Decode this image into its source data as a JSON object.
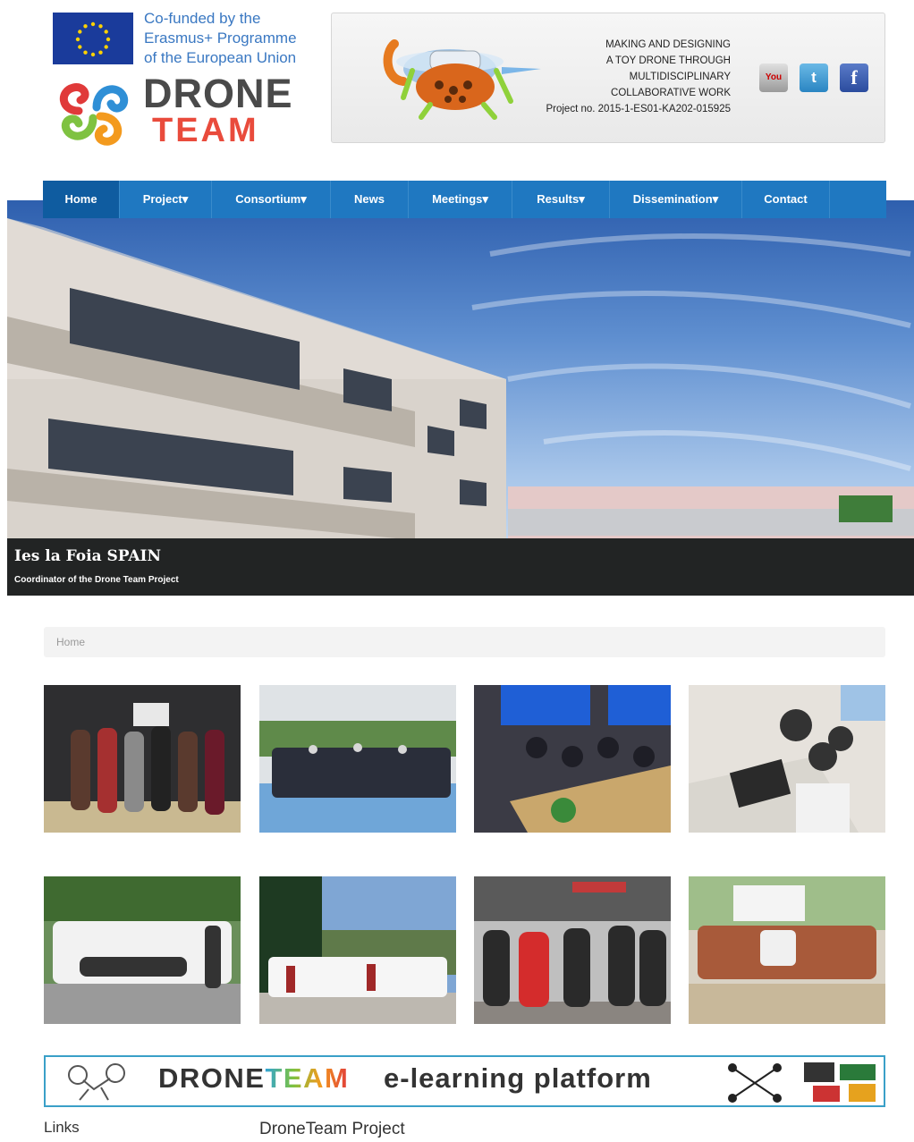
{
  "header": {
    "eu_lines": [
      "Co-funded by the",
      "Erasmus+ Programme",
      "of the European Union"
    ],
    "logo_word1": "DRONE",
    "logo_word2": "TEAM",
    "banner_lines": [
      "MAKING AND DESIGNING",
      "A TOY DRONE THROUGH",
      "MULTIDISCIPLINARY",
      "COLLABORATIVE WORK",
      "Project no. 2015-1-ES01-KA202-015925"
    ],
    "social": {
      "youtube": "You",
      "twitter": "t",
      "facebook": "f"
    }
  },
  "nav": {
    "items": [
      {
        "label": "Home",
        "active": true
      },
      {
        "label": "Project",
        "dropdown": true
      },
      {
        "label": "Consortium",
        "dropdown": true
      },
      {
        "label": "News",
        "dropdown": false
      },
      {
        "label": "Meetings",
        "dropdown": true
      },
      {
        "label": "Results",
        "dropdown": true
      },
      {
        "label": "Dissemination",
        "dropdown": true
      },
      {
        "label": "Contact",
        "dropdown": false
      }
    ],
    "caret": "▾"
  },
  "hero": {
    "title": "Ies la Foia SPAIN",
    "subtitle": "Coordinator of the Drone Team Project"
  },
  "breadcrumb": {
    "current": "Home"
  },
  "elearning": {
    "word1a": "DRONE",
    "word1b": "TEAM",
    "word2": "e-learning platform"
  },
  "footer": {
    "links_heading": "Links",
    "project_heading": "DroneTeam Project"
  },
  "colors": {
    "nav": "#1f78c1",
    "nav_active": "#0f5ca0",
    "team_red": "#e94b3c",
    "eu_blue": "#1a3b9b",
    "elearn_border": "#3aa0c8"
  }
}
